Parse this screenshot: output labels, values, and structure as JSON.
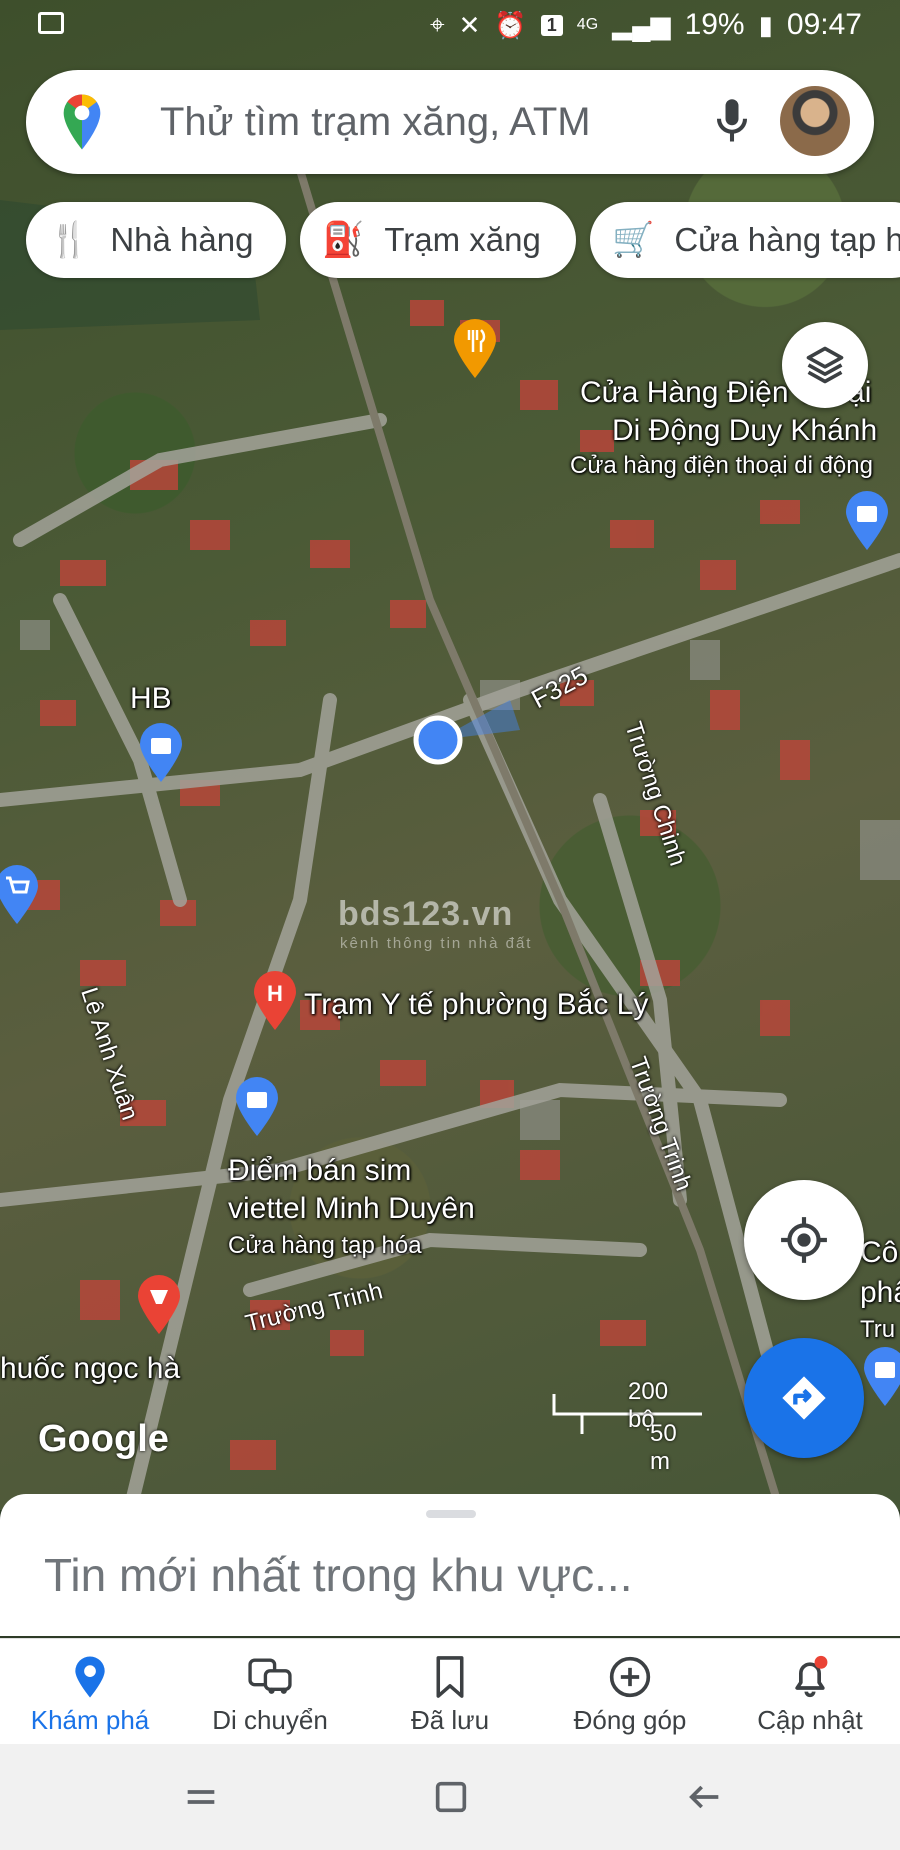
{
  "status_bar": {
    "battery": "19%",
    "time": "09:47",
    "sim_badge": "1",
    "network": "4G"
  },
  "search": {
    "placeholder": "Thử tìm trạm xăng, ATM"
  },
  "chips": [
    {
      "label": "Nhà hàng",
      "icon": "restaurant-icon"
    },
    {
      "label": "Trạm xăng",
      "icon": "gas-station-icon"
    },
    {
      "label": "Cửa hàng tạp h",
      "icon": "shopping-cart-icon"
    }
  ],
  "map": {
    "places": {
      "duy_khanh_line1": "Cửa Hàng Điện Thoại",
      "duy_khanh_line2": "Di Động Duy Khánh",
      "duy_khanh_type": "Cửa hàng điện thoại di động",
      "hb": "HB",
      "tram_y_te": "Trạm Y tế phường Bắc Lý",
      "sim_line1": "Điểm bán sim",
      "sim_line2": "viettel Minh Duyên",
      "sim_type": "Cửa hàng tạp hóa",
      "thuoc": "huốc ngọc hà",
      "right_edge_1": "Cô",
      "right_edge_2": "phẩ",
      "right_edge_3": "Tru"
    },
    "roads": {
      "f325": "F325",
      "truong_chinh": "Trường Chinh",
      "le_anh_xuan": "Lê Anh Xuân",
      "truong_trinh_1": "Trường Trinh",
      "truong_trinh_2": "Trường Trinh"
    },
    "scale": {
      "imperial": "200 bộ",
      "metric": "50 m"
    },
    "logo": "Google",
    "watermark": "bds123.vn",
    "watermark_sub": "kênh thông tin nhà đất"
  },
  "sheet": {
    "title": "Tin mới nhất trong khu vực..."
  },
  "bottom_nav": [
    {
      "label": "Khám phá",
      "icon": "explore-pin-icon",
      "active": true
    },
    {
      "label": "Di chuyển",
      "icon": "commute-icon",
      "active": false
    },
    {
      "label": "Đã lưu",
      "icon": "bookmark-icon",
      "active": false
    },
    {
      "label": "Đóng góp",
      "icon": "add-circle-icon",
      "active": false
    },
    {
      "label": "Cập nhật",
      "icon": "bell-icon",
      "active": false
    }
  ],
  "colors": {
    "accent": "#1a73e8",
    "poi_blue": "#4285f4",
    "poi_orange": "#f29900",
    "poi_red": "#ea4335"
  }
}
